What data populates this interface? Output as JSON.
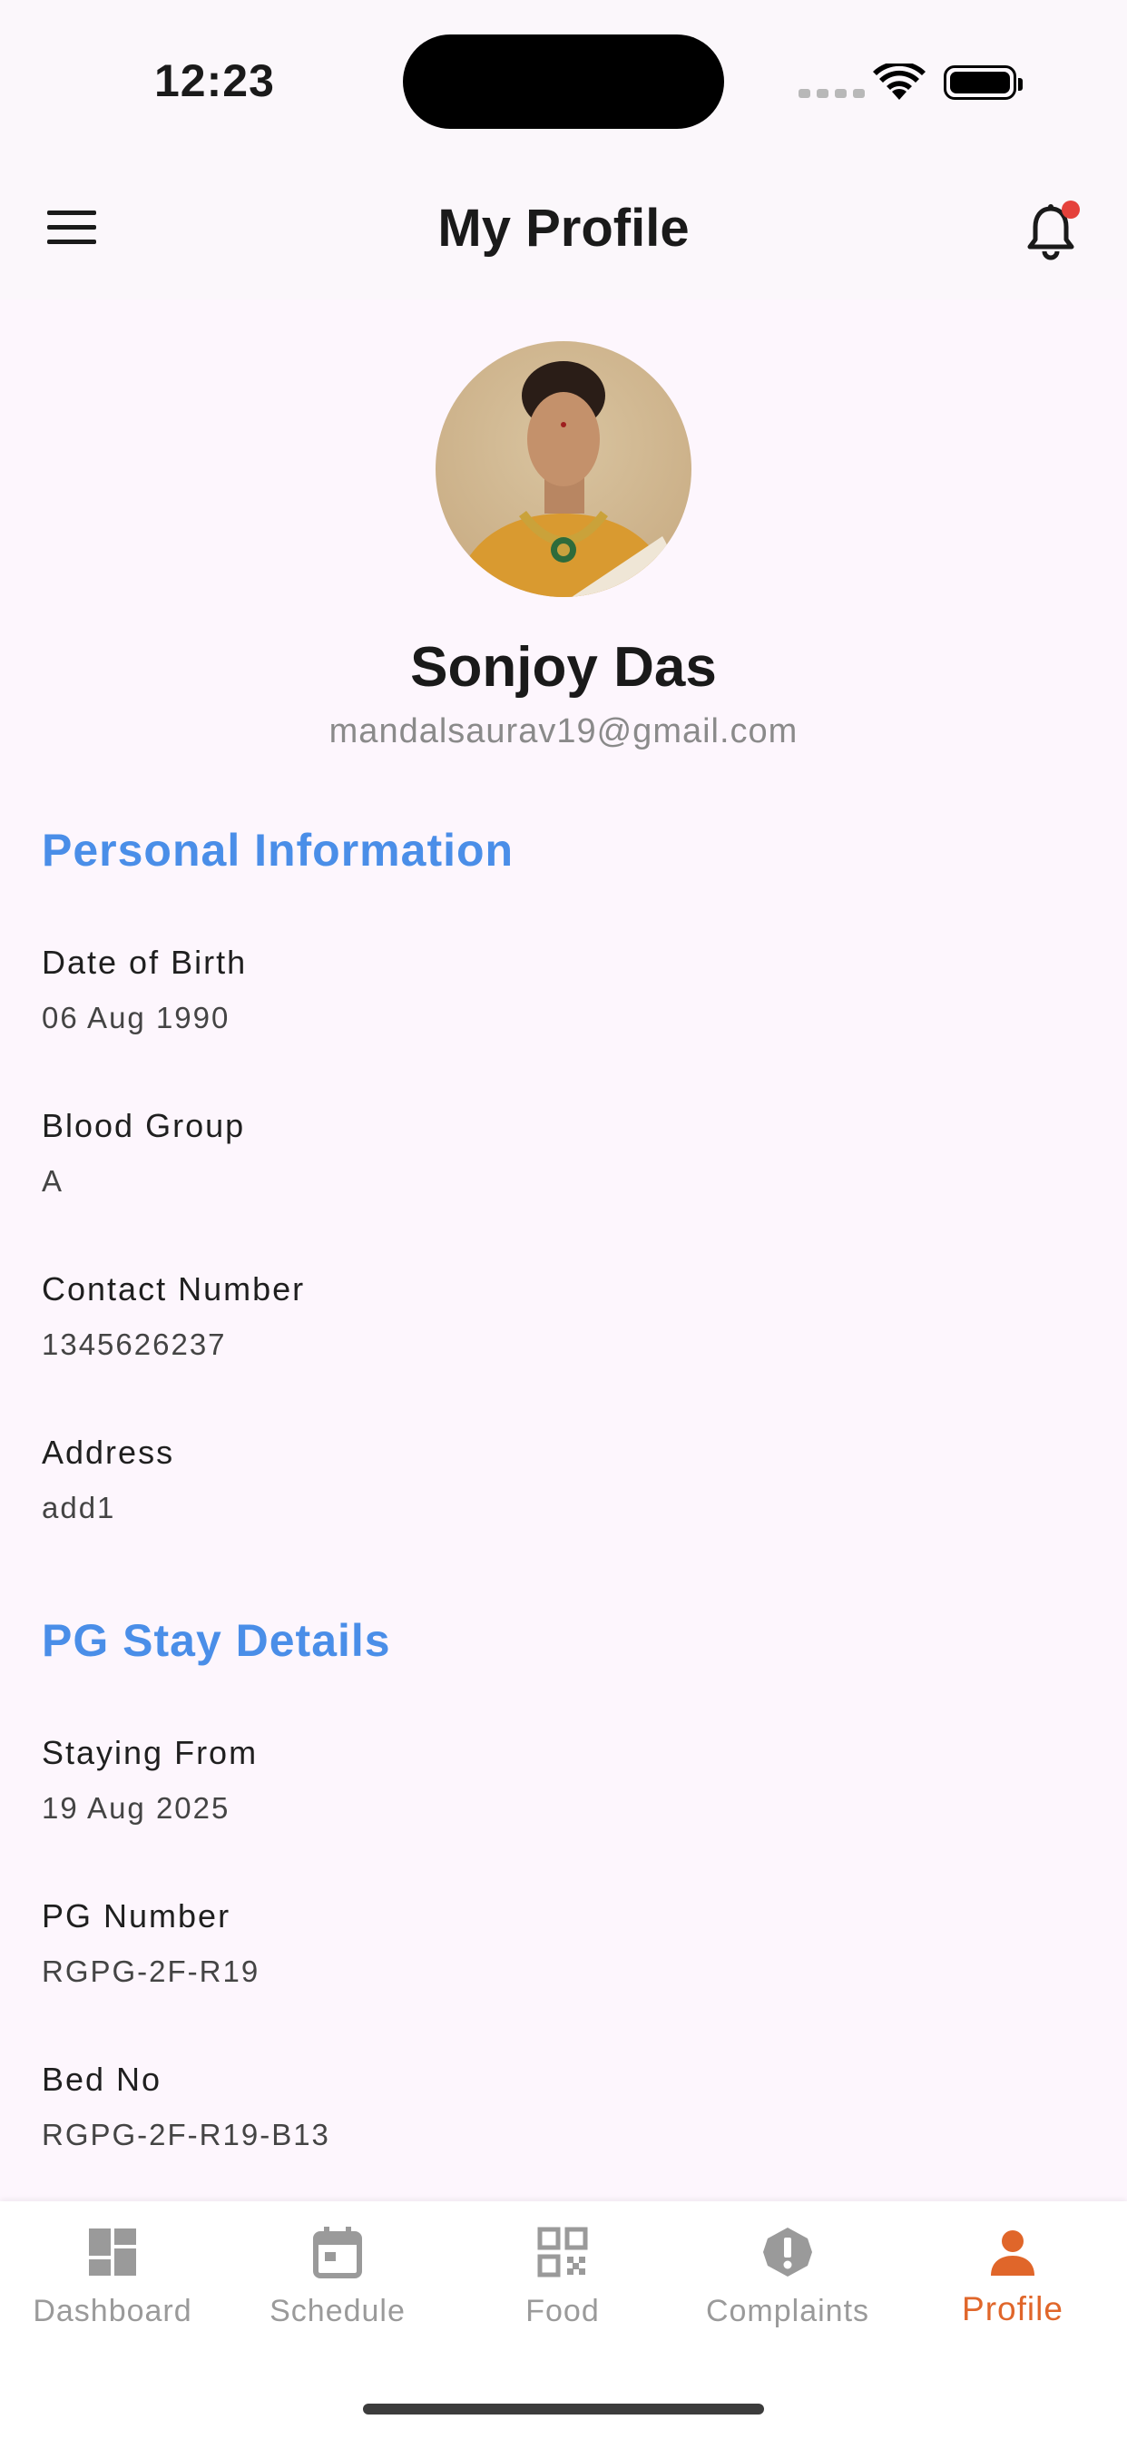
{
  "status_bar": {
    "time": "12:23"
  },
  "header": {
    "title": "My Profile",
    "notification_dot_color": "#e5413b"
  },
  "profile": {
    "name": "Sonjoy Das",
    "email": "mandalsaurav19@gmail.com"
  },
  "personal_information": {
    "title": "Personal Information",
    "fields": [
      {
        "label": "Date of Birth",
        "value": "06 Aug 1990"
      },
      {
        "label": "Blood Group",
        "value": "A"
      },
      {
        "label": "Contact Number",
        "value": "1345626237"
      },
      {
        "label": "Address",
        "value": "add1"
      }
    ]
  },
  "pg_stay_details": {
    "title": "PG Stay Details",
    "fields": [
      {
        "label": "Staying From",
        "value": "19 Aug 2025"
      },
      {
        "label": "PG Number",
        "value": "RGPG-2F-R19"
      },
      {
        "label": "Bed No",
        "value": "RGPG-2F-R19-B13"
      }
    ]
  },
  "bottom_nav": {
    "items": [
      {
        "label": "Dashboard",
        "icon": "dashboard-icon"
      },
      {
        "label": "Schedule",
        "icon": "calendar-icon"
      },
      {
        "label": "Food",
        "icon": "qr-code-icon"
      },
      {
        "label": "Complaints",
        "icon": "alert-icon"
      },
      {
        "label": "Profile",
        "icon": "person-icon",
        "active": true
      }
    ]
  },
  "colors": {
    "accent": "#4a8ee8",
    "active_nav": "#e0662a",
    "background": "#fdf6fd"
  }
}
